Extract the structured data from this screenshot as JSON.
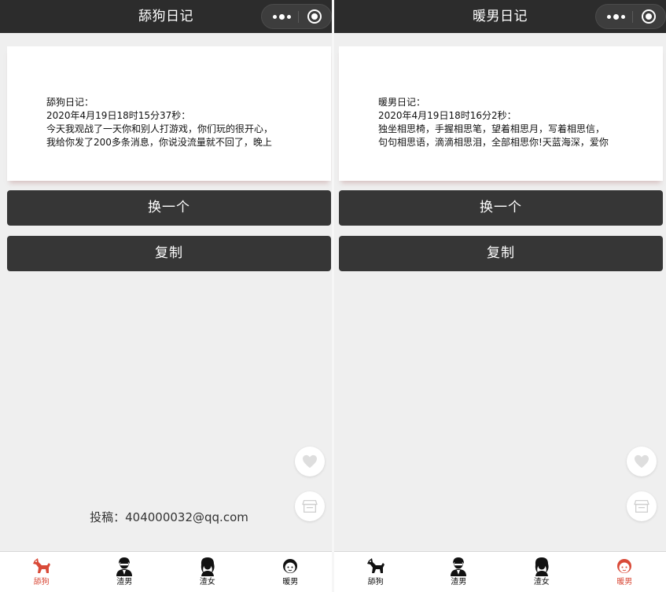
{
  "colors": {
    "accent": "#d94a38",
    "nav_bg": "#2c2c2c",
    "button_bg": "#363636",
    "page_bg": "#efefef"
  },
  "left": {
    "nav_title": "舔狗日记",
    "card": {
      "lines": [
        "舔狗日记：",
        "2020年4月19日18时15分37秒：",
        "今天我观战了一天你和别人打游戏，你们玩的很开心，",
        "我给你发了200多条消息，你说没流量就不回了，晚上"
      ]
    },
    "swap_label": "换一个",
    "copy_label": "复制",
    "contribute": "投稿：404000032@qq.com",
    "tabs": [
      {
        "label": "舔狗",
        "icon": "dog-icon"
      },
      {
        "label": "渣男",
        "icon": "scumbag-man-icon"
      },
      {
        "label": "渣女",
        "icon": "scumbag-woman-icon"
      },
      {
        "label": "暖男",
        "icon": "warm-man-icon"
      }
    ],
    "active_tab": 0
  },
  "right": {
    "nav_title": "暖男日记",
    "card": {
      "lines": [
        "暖男日记：",
        "2020年4月19日18时16分2秒：",
        "独坐相思椅，手握相思笔，望着相思月，写着相思信，",
        "句句相思语，滴滴相思泪，全部相思你!天蓝海深，爱你"
      ]
    },
    "swap_label": "换一个",
    "copy_label": "复制",
    "tabs": [
      {
        "label": "舔狗",
        "icon": "dog-icon"
      },
      {
        "label": "渣男",
        "icon": "scumbag-man-icon"
      },
      {
        "label": "渣女",
        "icon": "scumbag-woman-icon"
      },
      {
        "label": "暖男",
        "icon": "warm-man-icon"
      }
    ],
    "active_tab": 3
  }
}
